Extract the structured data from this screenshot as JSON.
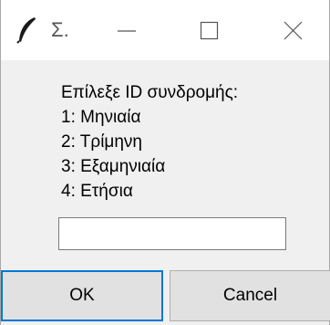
{
  "window": {
    "title": "Σ."
  },
  "icons": {
    "app": "feather-icon",
    "minimize": "minimize-icon",
    "maximize": "maximize-icon",
    "close": "close-icon"
  },
  "dialog": {
    "prompt_lines": [
      "Επίλεξε ID συνδρομής:",
      "1: Μηνιαία",
      "2: Τρίμηνη",
      "3: Εξαμηνιαία",
      "4: Ετήσια"
    ],
    "input_value": ""
  },
  "buttons": {
    "ok": "OK",
    "cancel": "Cancel"
  },
  "colors": {
    "focus_border": "#0078d7",
    "button_bg": "#e1e1e1",
    "window_bg": "#f0f0f0"
  }
}
